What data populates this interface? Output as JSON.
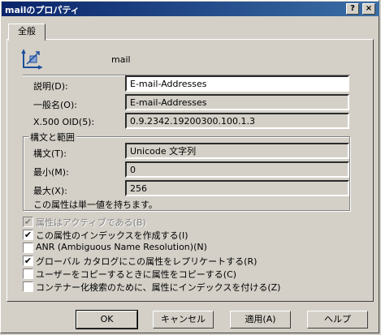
{
  "window": {
    "title": "mailのプロパティ",
    "help_glyph": "?",
    "close_glyph": "×"
  },
  "tabs": [
    {
      "label": "全般"
    }
  ],
  "object": {
    "name": "mail",
    "icon": "attribute-icon"
  },
  "fields": {
    "description": {
      "label": "説明(D):",
      "value": "E-mail-Addresses"
    },
    "common_name": {
      "label": "一般名(O):",
      "value": "E-mail-Addresses"
    },
    "oid": {
      "label": "X.500 OID(5):",
      "value": "0.9.2342.19200300.100.1.3"
    }
  },
  "syntax_group": {
    "title": "構文と範囲",
    "syntax": {
      "label": "構文(T):",
      "value": "Unicode 文字列"
    },
    "min": {
      "label": "最小(M):",
      "value": "0"
    },
    "max": {
      "label": "最大(X):",
      "value": "256"
    },
    "note": "この属性は単一値を持ちます。"
  },
  "checkboxes": [
    {
      "label": "属性はアクティブである(B)",
      "checked": true,
      "disabled": true
    },
    {
      "label": "この属性のインデックスを作成する(I)",
      "checked": true,
      "disabled": false
    },
    {
      "label": "ANR (Ambiguous Name Resolution)(N)",
      "checked": false,
      "disabled": false
    },
    {
      "label": "グローバル カタログにこの属性をレプリケートする(R)",
      "checked": true,
      "disabled": false
    },
    {
      "label": "ユーザーをコピーするときに属性をコピーする(C)",
      "checked": false,
      "disabled": false
    },
    {
      "label": "コンテナー化検索のために、属性にインデックスを付ける(Z)",
      "checked": false,
      "disabled": false
    }
  ],
  "buttons": {
    "ok": "OK",
    "cancel": "キャンセル",
    "apply": "適用(A)",
    "help": "ヘルプ"
  }
}
